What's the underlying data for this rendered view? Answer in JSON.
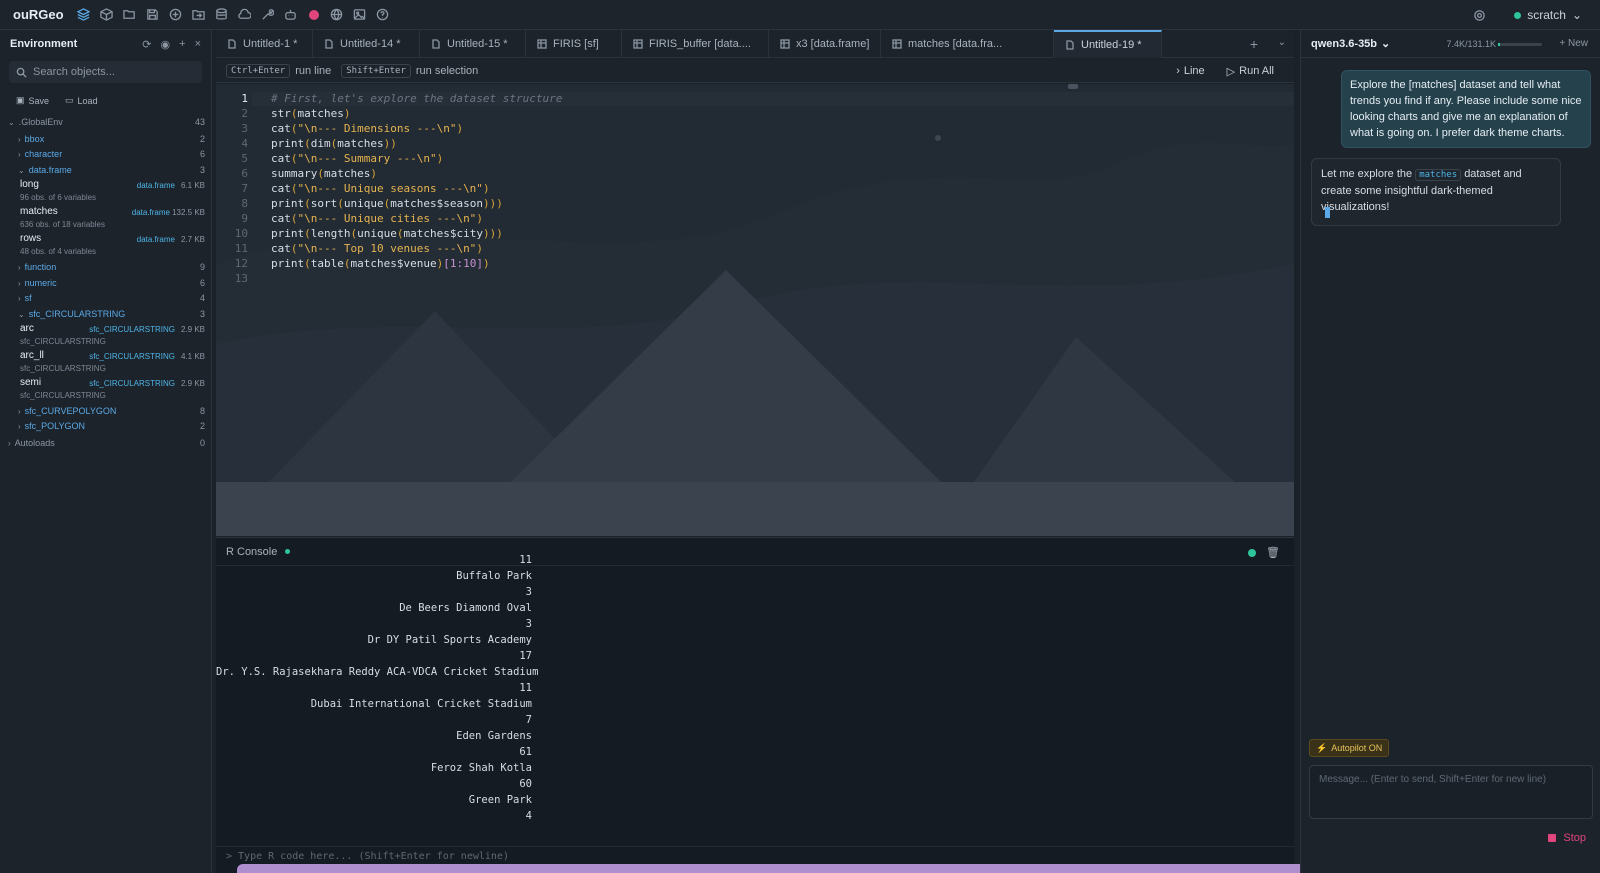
{
  "app": {
    "title": "ouRGeo",
    "project": "scratch"
  },
  "left": {
    "title": "Environment",
    "search_placeholder": "Search objects...",
    "save": "Save",
    "load": "Load",
    "global": {
      "name": ".GlobalEnv",
      "count": "43"
    },
    "groups": [
      {
        "name": "bbox",
        "count": "2"
      },
      {
        "name": "character",
        "count": "6"
      },
      {
        "name": "data.frame",
        "count": "3"
      },
      {
        "name": "function",
        "count": "9"
      },
      {
        "name": "numeric",
        "count": "6"
      },
      {
        "name": "sf",
        "count": "4"
      },
      {
        "name": "sfc_CIRCULARSTRING",
        "count": "3"
      },
      {
        "name": "sfc_CURVEPOLYGON",
        "count": "8"
      },
      {
        "name": "sfc_POLYGON",
        "count": "2"
      }
    ],
    "dataframes": [
      {
        "name": "long",
        "type": "data.frame",
        "size": "6.1 KB",
        "sub": "96 obs. of 6 variables"
      },
      {
        "name": "matches",
        "type": "data.frame",
        "size": "132.5 KB",
        "sub": "636 obs. of 18 variables"
      },
      {
        "name": "rows",
        "type": "data.frame",
        "size": "2.7 KB",
        "sub": "48 obs. of 4 variables"
      }
    ],
    "circular": [
      {
        "name": "arc",
        "type": "sfc_CIRCULARSTRING",
        "size": "2.9 KB",
        "sub": "sfc_CIRCULARSTRING"
      },
      {
        "name": "arc_ll",
        "type": "sfc_CIRCULARSTRING",
        "size": "4.1 KB",
        "sub": "sfc_CIRCULARSTRING"
      },
      {
        "name": "semi",
        "type": "sfc_CIRCULARSTRING",
        "size": "2.9 KB",
        "sub": "sfc_CIRCULARSTRING"
      }
    ],
    "autoloads": {
      "name": "Autoloads",
      "count": "0"
    }
  },
  "tabs": [
    "Untitled-1 *",
    "Untitled-14 *",
    "Untitled-15 *",
    "FIRIS [sf]",
    "FIRIS_buffer [data....",
    "x3 [data.frame]",
    "matches [data.fra...",
    "Untitled-19 *"
  ],
  "toolbar": {
    "k1": "Ctrl+Enter",
    "t1": "run line",
    "k2": "Shift+Enter",
    "t2": "run selection",
    "line": "Line",
    "runall": "Run All"
  },
  "console": {
    "title": "R Console",
    "lines": [
      "11",
      "Buffalo Park",
      "3",
      "De Beers Diamond Oval",
      "3",
      "Dr DY Patil Sports Academy",
      "17",
      "Dr. Y.S. Rajasekhara Reddy ACA-VDCA Cricket Stadium",
      "11",
      "Dubai International Cricket Stadium",
      "7",
      "Eden Gardens",
      "61",
      "Feroz Shah Kotla",
      "60",
      "Green Park",
      "4"
    ],
    "input_placeholder": "> Type R code here... (Shift+Enter for newline)"
  },
  "chat": {
    "model": "qwen3.6-35b",
    "tokens": "7.4K/131.1K",
    "new": "New",
    "user_msg": "Explore the [matches] dataset and tell what trends you find if any. Please include some nice looking charts and give me an explanation of what is going on. I prefer dark theme charts.",
    "ai_pre": "Let me explore the",
    "ai_tag": "matches",
    "ai_post": "dataset and create some insightful dark-themed visualizations!",
    "autopilot": "Autopilot ON",
    "input_placeholder": "Message... (Enter to send, Shift+Enter for new line)",
    "stop": "Stop"
  },
  "colors": {
    "accent": "#5aa9e6",
    "stop": "#e0457b",
    "ok": "#2fc59a"
  }
}
